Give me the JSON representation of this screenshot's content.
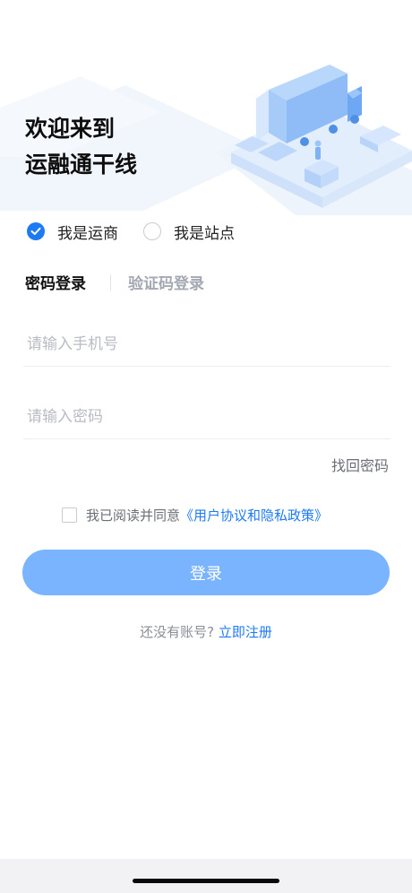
{
  "welcome": {
    "line1": "欢迎来到",
    "line2": "运融通干线"
  },
  "roles": [
    {
      "label": "我是运商",
      "checked": true
    },
    {
      "label": "我是站点",
      "checked": false
    }
  ],
  "tabs": [
    {
      "label": "密码登录",
      "active": true
    },
    {
      "label": "验证码登录",
      "active": false
    }
  ],
  "form": {
    "phone_placeholder": "请输入手机号",
    "password_placeholder": "请输入密码",
    "forgot_label": "找回密码"
  },
  "agreement": {
    "checked": false,
    "text": "我已阅读并同意",
    "link": "《用户协议和隐私政策》"
  },
  "login_button": "登录",
  "register": {
    "question": "还没有账号?",
    "link": "立即注册"
  },
  "colors": {
    "accent": "#1d7af2",
    "button_bg": "#7ab4ff",
    "placeholder": "#b8bcc4",
    "muted_text": "#6b6f76"
  },
  "icons": {
    "role_checked": "checkmark-icon",
    "hero": "delivery-truck-illustration"
  }
}
